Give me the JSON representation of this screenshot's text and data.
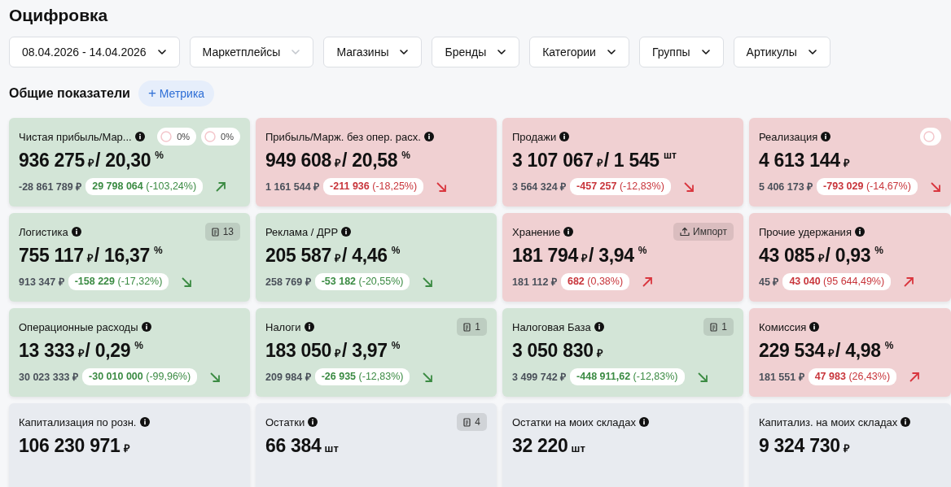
{
  "page_title": "Оцифровка",
  "filters": [
    {
      "label": "08.04.2026 - 14.04.2026",
      "disabled": false
    },
    {
      "label": "Маркетплейсы",
      "disabled": true
    },
    {
      "label": "Магазины",
      "disabled": false
    },
    {
      "label": "Бренды",
      "disabled": false
    },
    {
      "label": "Категории",
      "disabled": false
    },
    {
      "label": "Группы",
      "disabled": false
    },
    {
      "label": "Артикулы",
      "disabled": false
    }
  ],
  "section": {
    "title": "Общие показатели",
    "add_button": {
      "icon": "+",
      "label": "Метрика"
    }
  },
  "cards": [
    {
      "title": "Чистая прибыль/Мар...",
      "kind": "positive",
      "badges": [
        {
          "kind": "ring",
          "text": "0%"
        },
        {
          "kind": "ring",
          "text": "0%"
        }
      ],
      "value": "936 275",
      "unit": "₽",
      "second_value": "/ 20,30",
      "second_unit": "%",
      "previous": "-28 861 789 ₽",
      "delta": "29 798 064",
      "delta_percent": "(-103,24%)",
      "rising": true
    },
    {
      "title": "Прибыль/Марж. без опер. расх.",
      "kind": "negative",
      "value": "949 608",
      "unit": "₽",
      "second_value": "/ 20,58",
      "second_unit": "%",
      "previous": "1 161 544 ₽",
      "delta": "-211 936",
      "delta_percent": "(-18,25%)",
      "rising": false
    },
    {
      "title": "Продажи",
      "kind": "negative",
      "value": "3 107 067",
      "unit": "₽",
      "second_value": "/ 1 545",
      "second_unit": "шт",
      "previous": "3 564 324 ₽",
      "delta": "-457 257",
      "delta_percent": "(-12,83%)",
      "rising": false
    },
    {
      "title": "Реализация",
      "kind": "negative",
      "badges": [
        {
          "kind": "ring"
        }
      ],
      "value": "4 613 144",
      "unit": "₽",
      "previous": "5 406 173 ₽",
      "delta": "-793 029",
      "delta_percent": "(-14,67%)",
      "rising": false
    },
    {
      "title": "Логистика",
      "kind": "positive",
      "badges": [
        {
          "kind": "docs",
          "text": "13"
        }
      ],
      "value": "755 117",
      "unit": "₽",
      "second_value": "/ 16,37",
      "second_unit": "%",
      "previous": "913 347 ₽",
      "delta": "-158 229",
      "delta_percent": "(-17,32%)",
      "rising": false
    },
    {
      "title": "Реклама / ДРР",
      "kind": "positive",
      "value": "205 587",
      "unit": "₽",
      "second_value": "/ 4,46",
      "second_unit": "%",
      "previous": "258 769 ₽",
      "delta": "-53 182",
      "delta_percent": "(-20,55%)",
      "rising": false
    },
    {
      "title": "Хранение",
      "kind": "negative",
      "badges": [
        {
          "kind": "import",
          "text": "Импорт"
        }
      ],
      "value": "181 794",
      "unit": "₽",
      "second_value": "/ 3,94",
      "second_unit": "%",
      "previous": "181 112 ₽",
      "delta": "682",
      "delta_percent": "(0,38%)",
      "rising": true
    },
    {
      "title": "Прочие удержания",
      "kind": "negative",
      "value": "43 085",
      "unit": "₽",
      "second_value": "/ 0,93",
      "second_unit": "%",
      "previous": "45 ₽",
      "delta": "43 040",
      "delta_percent": "(95 644,49%)",
      "rising": true
    },
    {
      "title": "Операционные расходы",
      "kind": "positive",
      "value": "13 333",
      "unit": "₽",
      "second_value": "/ 0,29",
      "second_unit": "%",
      "previous": "30 023 333 ₽",
      "delta": "-30 010 000",
      "delta_percent": "(-99,96%)",
      "rising": false
    },
    {
      "title": "Налоги",
      "kind": "positive",
      "badges": [
        {
          "kind": "docs",
          "text": "1"
        }
      ],
      "value": "183 050",
      "unit": "₽",
      "second_value": "/ 3,97",
      "second_unit": "%",
      "previous": "209 984 ₽",
      "delta": "-26 935",
      "delta_percent": "(-12,83%)",
      "rising": false
    },
    {
      "title": "Налоговая База",
      "kind": "positive",
      "badges": [
        {
          "kind": "docs",
          "text": "1"
        }
      ],
      "value": "3 050 830",
      "unit": "₽",
      "previous": "3 499 742 ₽",
      "delta": "-448 911,62",
      "delta_percent": "(-12,83%)",
      "rising": false
    },
    {
      "title": "Комиссия",
      "kind": "negative",
      "value": "229 534",
      "unit": "₽",
      "second_value": "/ 4,98",
      "second_unit": "%",
      "previous": "181 551 ₽",
      "delta": "47 983",
      "delta_percent": "(26,43%)",
      "rising": true
    },
    {
      "title": "Капитализация по розн.",
      "kind": "neutral",
      "value": "106 230 971",
      "unit": "₽"
    },
    {
      "title": "Остатки",
      "kind": "neutral",
      "badges": [
        {
          "kind": "docs",
          "text": "4"
        }
      ],
      "value": "66 384",
      "unit": "шт"
    },
    {
      "title": "Остатки на моих складах",
      "kind": "neutral",
      "value": "32 220",
      "unit": "шт"
    },
    {
      "title": "Капитализ. на моих складах",
      "kind": "neutral",
      "value": "9 324 730",
      "unit": "₽"
    }
  ]
}
